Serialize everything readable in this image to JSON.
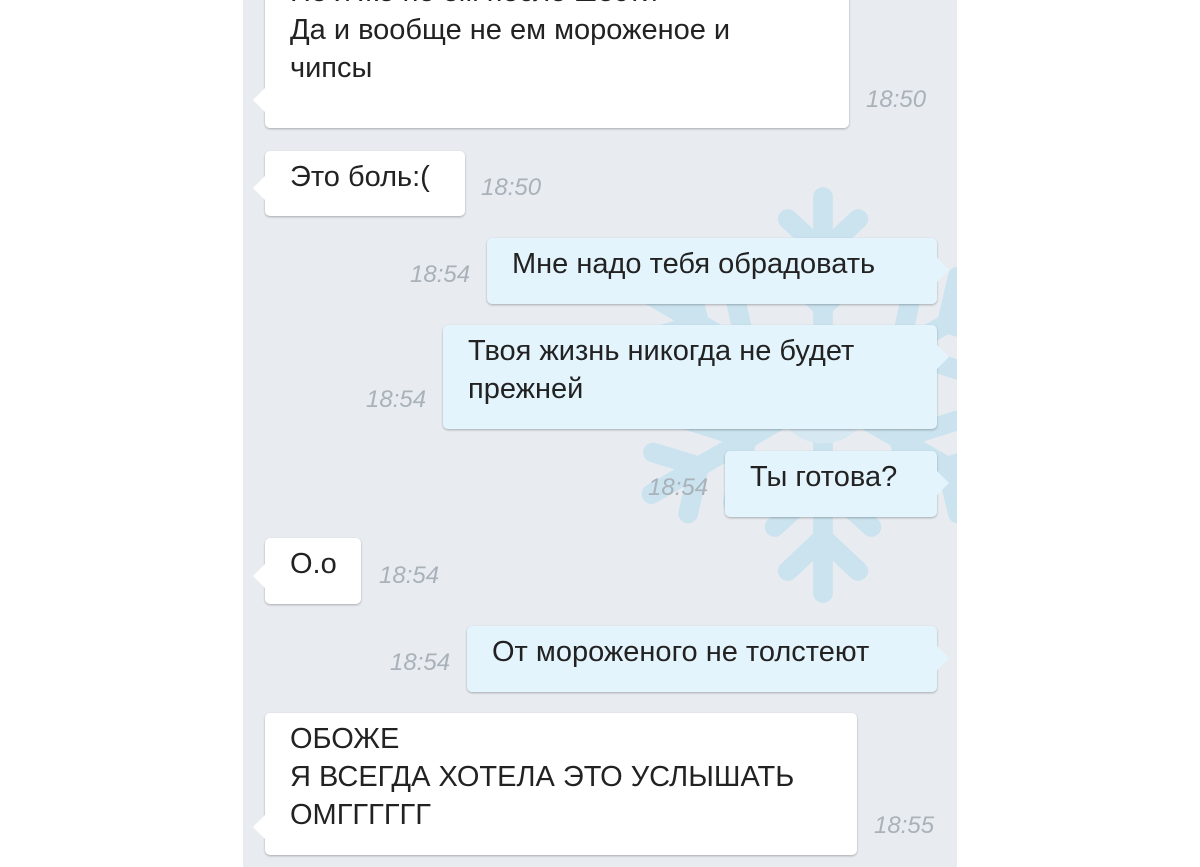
{
  "messages": [
    {
      "direction": "in",
      "text": "Но я же не ем после шести\nДа и вообще не ем мороженое и\nчипсы",
      "time": "18:50"
    },
    {
      "direction": "in",
      "text": "Это боль:(",
      "time": "18:50"
    },
    {
      "direction": "out",
      "text": "Мне надо тебя обрадовать",
      "time": "18:54"
    },
    {
      "direction": "out",
      "text": "Твоя жизнь никогда не будет\nпрежней",
      "time": "18:54"
    },
    {
      "direction": "out",
      "text": "Ты готова?",
      "time": "18:54"
    },
    {
      "direction": "in",
      "text": "О.о",
      "time": "18:54"
    },
    {
      "direction": "out",
      "text": "От мороженого не толстеют",
      "time": "18:54"
    },
    {
      "direction": "in",
      "text": "ОБОЖЕ\nЯ ВСЕГДА ХОТЕЛА ЭТО УСЛЫШАТЬ\nОМГГГГГГ",
      "time": "18:55"
    }
  ],
  "background": {
    "watermark_icon": "snowflake-icon",
    "color": "#e8ecf0",
    "watermark_color": "#b5dcef"
  },
  "colors": {
    "incoming_bubble": "#ffffff",
    "outgoing_bubble": "#e4f4fd",
    "timestamp": "#a9b1b9",
    "text": "#222222"
  }
}
